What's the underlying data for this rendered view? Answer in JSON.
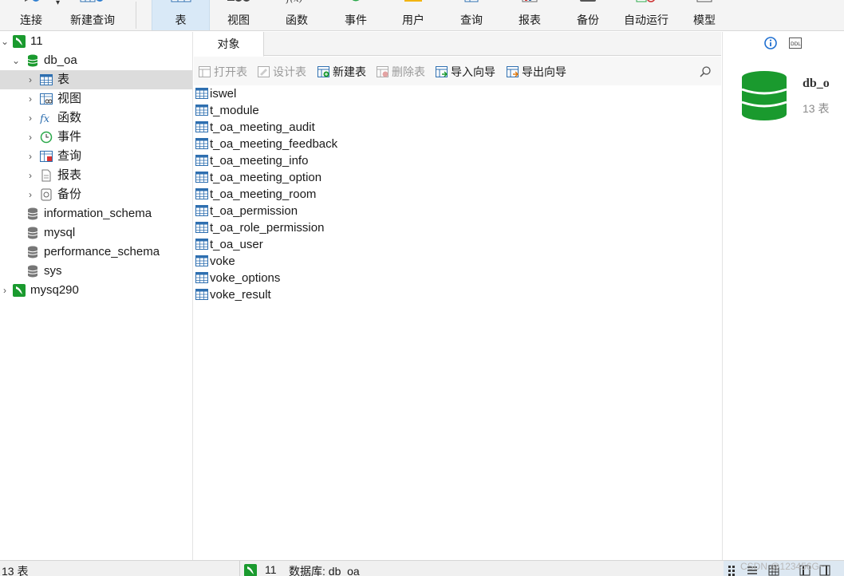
{
  "toolbar": {
    "connect": "连接",
    "new_query": "新建查询",
    "tabs": [
      {
        "label": "表",
        "icon": "table-icon",
        "active": true
      },
      {
        "label": "视图",
        "icon": "view-icon"
      },
      {
        "label": "函数",
        "icon": "function-icon"
      },
      {
        "label": "事件",
        "icon": "event-icon"
      },
      {
        "label": "用户",
        "icon": "user-icon"
      },
      {
        "label": "查询",
        "icon": "query-icon"
      },
      {
        "label": "报表",
        "icon": "report-icon"
      },
      {
        "label": "备份",
        "icon": "backup-icon"
      },
      {
        "label": "自动运行",
        "icon": "automation-icon"
      },
      {
        "label": "模型",
        "icon": "model-icon"
      }
    ]
  },
  "nav": {
    "connection_1": "11",
    "database": "db_oa",
    "db_children": [
      "表",
      "视图",
      "函数",
      "事件",
      "查询",
      "报表",
      "备份"
    ],
    "other_dbs": [
      "information_schema",
      "mysql",
      "performance_schema",
      "sys"
    ],
    "connection_2": "mysq290"
  },
  "center": {
    "tab_label": "对象",
    "toolbar": {
      "open_table": "打开表",
      "design_table": "设计表",
      "new_table": "新建表",
      "delete_table": "删除表",
      "import_wizard": "导入向导",
      "export_wizard": "导出向导"
    },
    "tables": [
      "iswel",
      "t_module",
      "t_oa_meeting_audit",
      "t_oa_meeting_feedback",
      "t_oa_meeting_info",
      "t_oa_meeting_option",
      "t_oa_meeting_room",
      "t_oa_permission",
      "t_oa_role_permission",
      "t_oa_user",
      "voke",
      "voke_options",
      "voke_result"
    ]
  },
  "info": {
    "db_name": "db_o",
    "table_count": "13 表"
  },
  "status": {
    "count": "13 表",
    "connection": "11",
    "database": "数据库: db_oa",
    "watermark": "CSDN @123456G~"
  },
  "colors": {
    "accent_green": "#1a9a2e",
    "table_icon_blue": "#2e6fb0",
    "active_tab_bg": "#d9e9f7"
  }
}
